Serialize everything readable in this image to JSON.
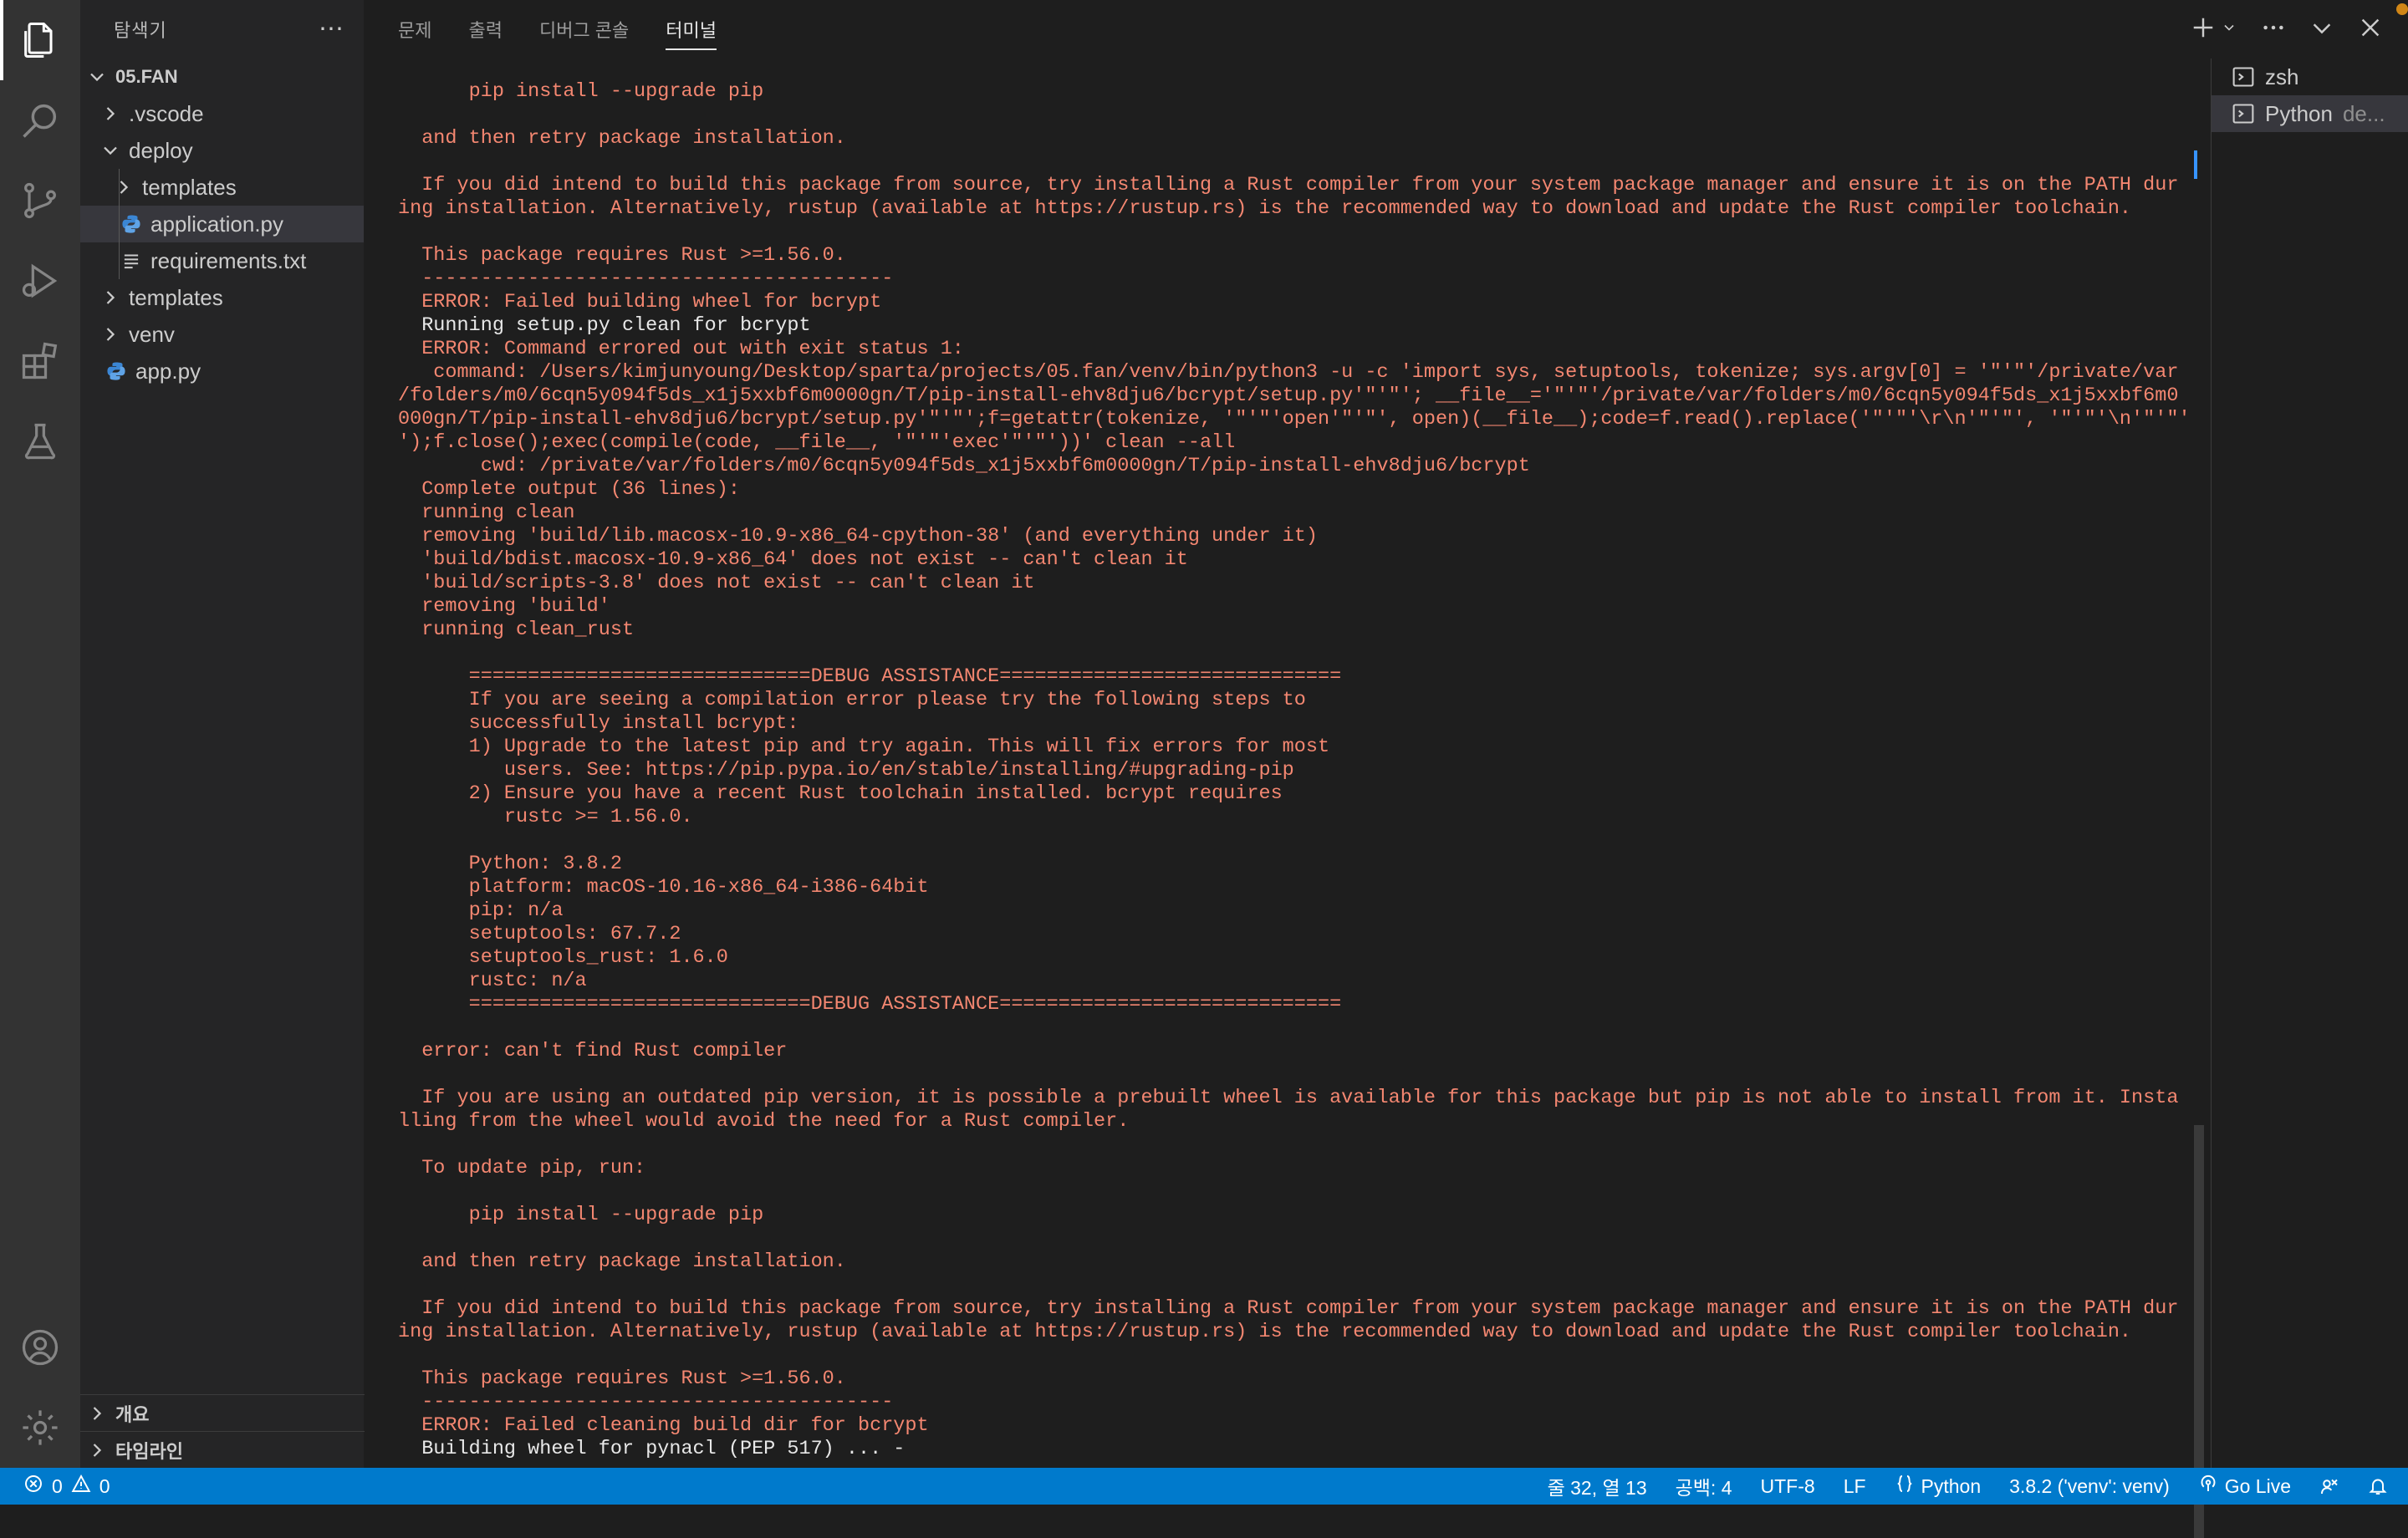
{
  "activity_bar": {
    "icons": [
      "explorer-icon",
      "search-icon",
      "source-control-icon",
      "run-debug-icon",
      "extensions-icon",
      "testing-icon"
    ],
    "bottom_icons": [
      "account-icon",
      "settings-gear-icon"
    ]
  },
  "sidebar": {
    "title": "탐색기",
    "more": "⋯",
    "root": "05.FAN",
    "items": [
      {
        "label": ".vscode"
      },
      {
        "label": "deploy"
      },
      {
        "label": "templates"
      },
      {
        "label": "application.py"
      },
      {
        "label": "requirements.txt"
      },
      {
        "label": "templates"
      },
      {
        "label": "venv"
      },
      {
        "label": "app.py"
      }
    ],
    "bottom_sections": [
      {
        "label": "개요"
      },
      {
        "label": "타임라인"
      }
    ]
  },
  "panel": {
    "tabs": [
      {
        "label": "문제"
      },
      {
        "label": "출력"
      },
      {
        "label": "디버그 콘솔"
      },
      {
        "label": "터미널"
      }
    ]
  },
  "terminal": {
    "lines": [
      {
        "text": "      pip install --upgrade pip",
        "color": "red"
      },
      {
        "text": "",
        "color": "red"
      },
      {
        "text": "  and then retry package installation.",
        "color": "red"
      },
      {
        "text": "",
        "color": "red"
      },
      {
        "text": "  If you did intend to build this package from source, try installing a Rust compiler from your system package manager and ensure it is on the PATH dur",
        "color": "red"
      },
      {
        "text": "ing installation. Alternatively, rustup (available at https://rustup.rs) is the recommended way to download and update the Rust compiler toolchain.",
        "color": "red"
      },
      {
        "text": "",
        "color": "red"
      },
      {
        "text": "  This package requires Rust >=1.56.0.",
        "color": "red"
      },
      {
        "text": "  ----------------------------------------",
        "color": "red"
      },
      {
        "text": "  ERROR: Failed building wheel for bcrypt",
        "color": "red"
      },
      {
        "text": "  Running setup.py clean for bcrypt",
        "color": "white"
      },
      {
        "text": "  ERROR: Command errored out with exit status 1:",
        "color": "red"
      },
      {
        "text": "   command: /Users/kimjunyoung/Desktop/sparta/projects/05.fan/venv/bin/python3 -u -c 'import sys, setuptools, tokenize; sys.argv[0] = '\"'\"'/private/var",
        "color": "red"
      },
      {
        "text": "/folders/m0/6cqn5y094f5ds_x1j5xxbf6m0000gn/T/pip-install-ehv8dju6/bcrypt/setup.py'\"'\"'; __file__='\"'\"'/private/var/folders/m0/6cqn5y094f5ds_x1j5xxbf6m0",
        "color": "red"
      },
      {
        "text": "000gn/T/pip-install-ehv8dju6/bcrypt/setup.py'\"'\"';f=getattr(tokenize, '\"'\"'open'\"'\"', open)(__file__);code=f.read().replace('\"'\"'\\r\\n'\"'\"', '\"'\"'\\n'\"'\"'",
        "color": "red"
      },
      {
        "text": "');f.close();exec(compile(code, __file__, '\"'\"'exec'\"'\"'))' clean --all",
        "color": "red"
      },
      {
        "text": "       cwd: /private/var/folders/m0/6cqn5y094f5ds_x1j5xxbf6m0000gn/T/pip-install-ehv8dju6/bcrypt",
        "color": "red"
      },
      {
        "text": "  Complete output (36 lines):",
        "color": "red"
      },
      {
        "text": "  running clean",
        "color": "red"
      },
      {
        "text": "  removing 'build/lib.macosx-10.9-x86_64-cpython-38' (and everything under it)",
        "color": "red"
      },
      {
        "text": "  'build/bdist.macosx-10.9-x86_64' does not exist -- can't clean it",
        "color": "red"
      },
      {
        "text": "  'build/scripts-3.8' does not exist -- can't clean it",
        "color": "red"
      },
      {
        "text": "  removing 'build'",
        "color": "red"
      },
      {
        "text": "  running clean_rust",
        "color": "red"
      },
      {
        "text": "",
        "color": "red"
      },
      {
        "text": "      =============================DEBUG ASSISTANCE=============================",
        "color": "red"
      },
      {
        "text": "      If you are seeing a compilation error please try the following steps to",
        "color": "red"
      },
      {
        "text": "      successfully install bcrypt:",
        "color": "red"
      },
      {
        "text": "      1) Upgrade to the latest pip and try again. This will fix errors for most",
        "color": "red"
      },
      {
        "text": "         users. See: https://pip.pypa.io/en/stable/installing/#upgrading-pip",
        "color": "red"
      },
      {
        "text": "      2) Ensure you have a recent Rust toolchain installed. bcrypt requires",
        "color": "red"
      },
      {
        "text": "         rustc >= 1.56.0.",
        "color": "red"
      },
      {
        "text": "",
        "color": "red"
      },
      {
        "text": "      Python: 3.8.2",
        "color": "red"
      },
      {
        "text": "      platform: macOS-10.16-x86_64-i386-64bit",
        "color": "red"
      },
      {
        "text": "      pip: n/a",
        "color": "red"
      },
      {
        "text": "      setuptools: 67.7.2",
        "color": "red"
      },
      {
        "text": "      setuptools_rust: 1.6.0",
        "color": "red"
      },
      {
        "text": "      rustc: n/a",
        "color": "red"
      },
      {
        "text": "      =============================DEBUG ASSISTANCE=============================",
        "color": "red"
      },
      {
        "text": "",
        "color": "red"
      },
      {
        "text": "  error: can't find Rust compiler",
        "color": "red"
      },
      {
        "text": "",
        "color": "red"
      },
      {
        "text": "  If you are using an outdated pip version, it is possible a prebuilt wheel is available for this package but pip is not able to install from it. Insta",
        "color": "red"
      },
      {
        "text": "lling from the wheel would avoid the need for a Rust compiler.",
        "color": "red"
      },
      {
        "text": "",
        "color": "red"
      },
      {
        "text": "  To update pip, run:",
        "color": "red"
      },
      {
        "text": "",
        "color": "red"
      },
      {
        "text": "      pip install --upgrade pip",
        "color": "red"
      },
      {
        "text": "",
        "color": "red"
      },
      {
        "text": "  and then retry package installation.",
        "color": "red"
      },
      {
        "text": "",
        "color": "red"
      },
      {
        "text": "  If you did intend to build this package from source, try installing a Rust compiler from your system package manager and ensure it is on the PATH dur",
        "color": "red"
      },
      {
        "text": "ing installation. Alternatively, rustup (available at https://rustup.rs) is the recommended way to download and update the Rust compiler toolchain.",
        "color": "red"
      },
      {
        "text": "",
        "color": "red"
      },
      {
        "text": "  This package requires Rust >=1.56.0.",
        "color": "red"
      },
      {
        "text": "  ----------------------------------------",
        "color": "red"
      },
      {
        "text": "  ERROR: Failed cleaning build dir for bcrypt",
        "color": "red"
      },
      {
        "text": "  Building wheel for pynacl (PEP 517) ... -",
        "color": "white"
      }
    ]
  },
  "terminal_list": [
    {
      "label": "zsh",
      "desc": ""
    },
    {
      "label": "Python",
      "desc": "de..."
    }
  ],
  "status_bar": {
    "errors": "0",
    "warnings": "0",
    "position": "줄 32, 열 13",
    "spaces": "공백: 4",
    "encoding": "UTF-8",
    "eol": "LF",
    "language": "Python",
    "interpreter": "3.8.2 ('venv': venv)",
    "go_live": "Go Live"
  },
  "colors": {
    "status_bar": "#007acc",
    "terminal_error": "#f48771",
    "python_icon": "#3b86d4",
    "notification_dot": "#d18616"
  }
}
